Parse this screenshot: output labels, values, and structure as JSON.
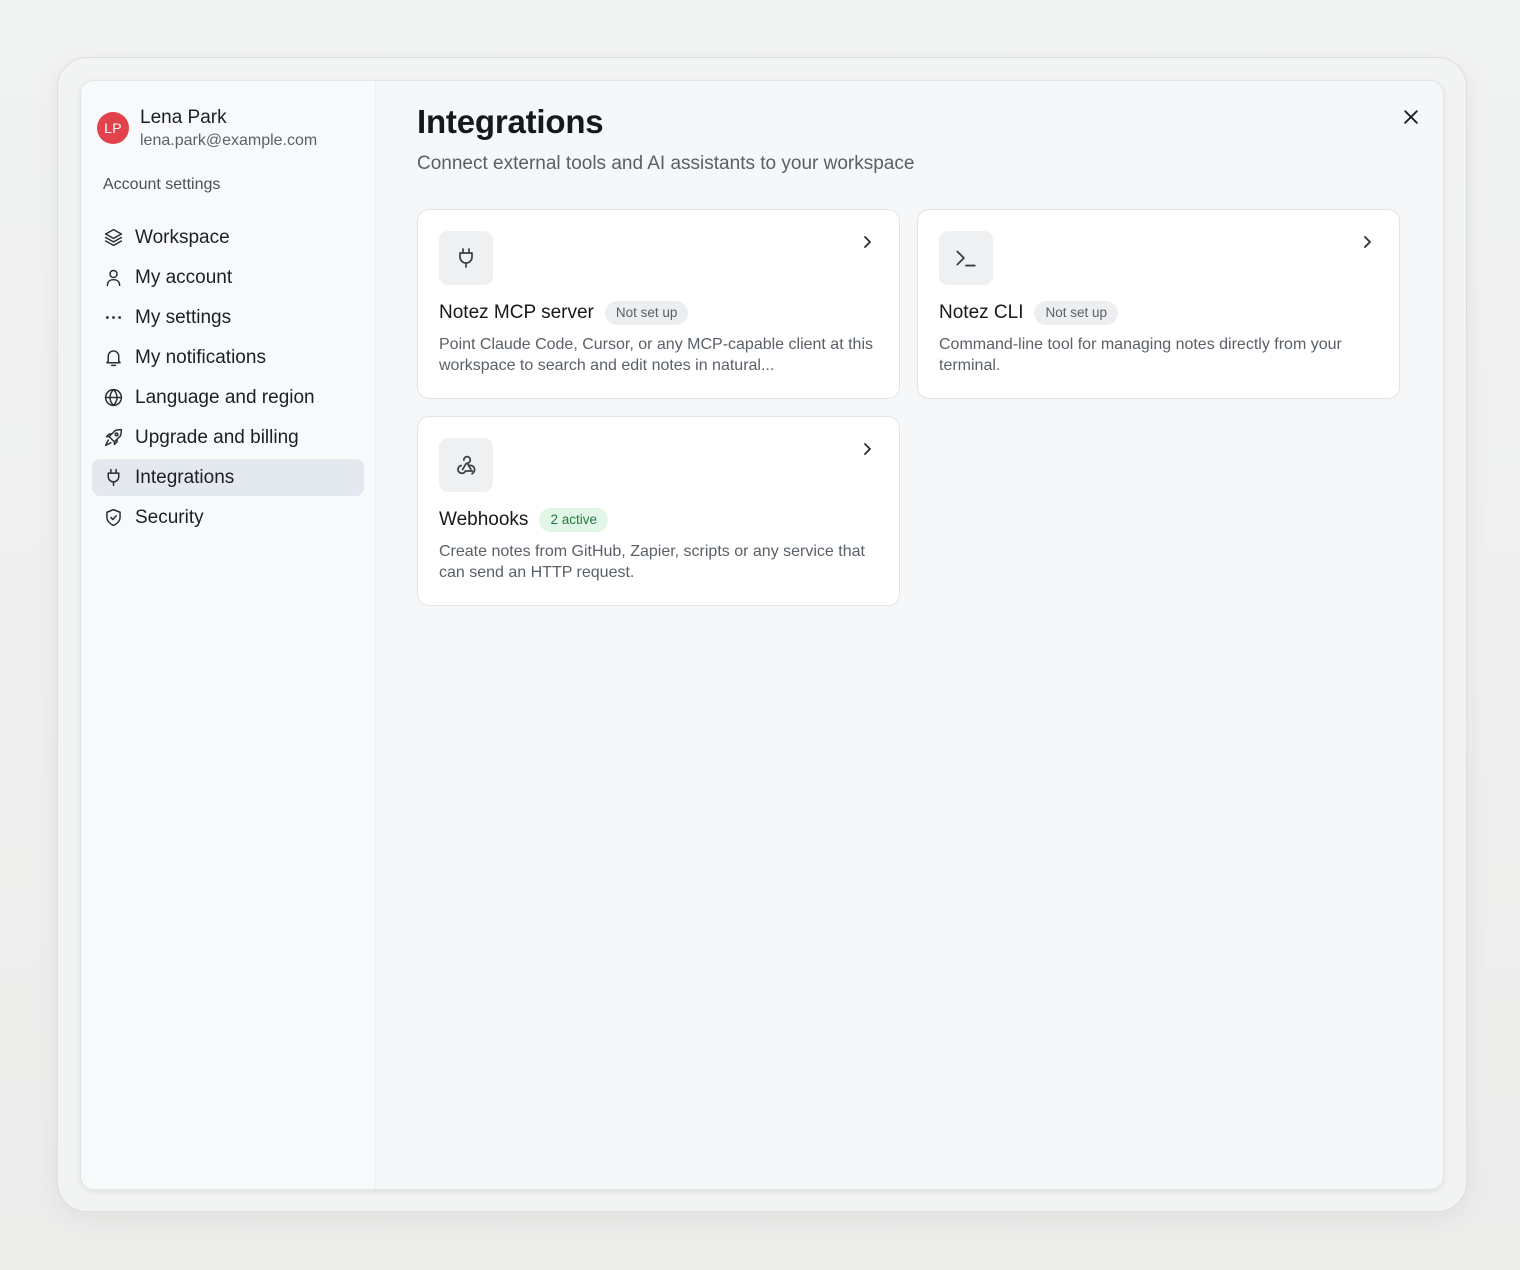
{
  "user": {
    "initials": "LP",
    "name": "Lena Park",
    "email": "lena.park@example.com",
    "avatar_color": "#e2424b"
  },
  "sidebar": {
    "section_label": "Account settings",
    "items": [
      {
        "label": "Workspace",
        "icon": "layers-icon",
        "active": false
      },
      {
        "label": "My account",
        "icon": "user-icon",
        "active": false
      },
      {
        "label": "My settings",
        "icon": "more-horizontal-icon",
        "active": false
      },
      {
        "label": "My notifications",
        "icon": "bell-icon",
        "active": false
      },
      {
        "label": "Language and region",
        "icon": "globe-icon",
        "active": false
      },
      {
        "label": "Upgrade and billing",
        "icon": "rocket-icon",
        "active": false
      },
      {
        "label": "Integrations",
        "icon": "plug-icon",
        "active": true
      },
      {
        "label": "Security",
        "icon": "shield-icon",
        "active": false
      }
    ]
  },
  "main": {
    "title": "Integrations",
    "subtitle": "Connect external tools and AI assistants to your workspace",
    "close_icon": "close-icon",
    "cards": [
      {
        "title": "Notez MCP server",
        "icon": "plug-icon",
        "status": "Not set up",
        "status_kind": "neutral",
        "description": "Point Claude Code, Cursor, or any MCP-capable client at this workspace to search and edit notes in natural..."
      },
      {
        "title": "Notez CLI",
        "icon": "terminal-icon",
        "status": "Not set up",
        "status_kind": "neutral",
        "description": "Command-line tool for managing notes directly from your terminal."
      },
      {
        "title": "Webhooks",
        "icon": "webhook-icon",
        "status": "2 active",
        "status_kind": "success",
        "description": "Create notes from GitHub, Zapier, scripts or any service that can send an HTTP request."
      }
    ]
  },
  "colors": {
    "active_nav_bg": "#e4e9ef",
    "success_badge_bg": "#e1f6e7",
    "success_badge_text": "#1f7a3d",
    "neutral_badge_bg": "#eceef0"
  }
}
